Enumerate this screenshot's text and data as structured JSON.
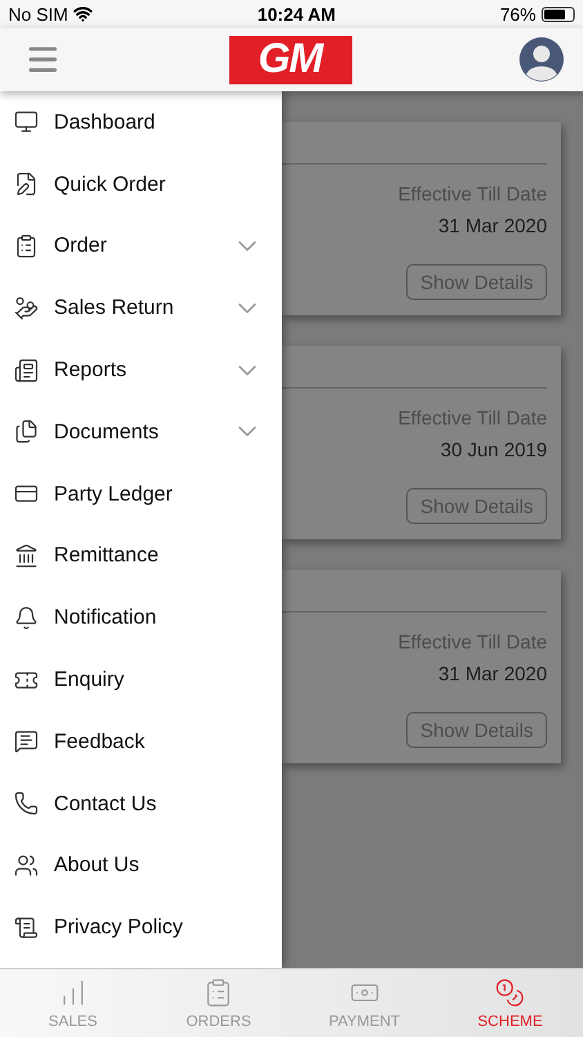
{
  "status_bar": {
    "carrier": "No SIM",
    "time": "10:24 AM",
    "battery": "76%"
  },
  "header": {
    "logo": "GM"
  },
  "drawer": {
    "items": [
      {
        "label": "Dashboard",
        "expandable": false
      },
      {
        "label": "Quick Order",
        "expandable": false
      },
      {
        "label": "Order",
        "expandable": true
      },
      {
        "label": "Sales Return",
        "expandable": true
      },
      {
        "label": "Reports",
        "expandable": true
      },
      {
        "label": "Documents",
        "expandable": true
      },
      {
        "label": "Party Ledger",
        "expandable": false
      },
      {
        "label": "Remittance",
        "expandable": false
      },
      {
        "label": "Notification",
        "expandable": false
      },
      {
        "label": "Enquiry",
        "expandable": false
      },
      {
        "label": "Feedback",
        "expandable": false
      },
      {
        "label": "Contact Us",
        "expandable": false
      },
      {
        "label": "About Us",
        "expandable": false
      },
      {
        "label": "Privacy Policy",
        "expandable": false
      }
    ]
  },
  "schemes": [
    {
      "label": "Effective Till Date",
      "date": "31 Mar 2020",
      "button": "Show Details"
    },
    {
      "label": "Effective Till Date",
      "date": "30 Jun 2019",
      "button": "Show Details"
    },
    {
      "label": "Effective Till Date",
      "date": "31 Mar 2020",
      "button": "Show Details"
    }
  ],
  "tab_bar": [
    {
      "label": "SALES",
      "selected": false
    },
    {
      "label": "ORDERS",
      "selected": false
    },
    {
      "label": "PAYMENT",
      "selected": false
    },
    {
      "label": "SCHEME",
      "selected": true
    }
  ]
}
